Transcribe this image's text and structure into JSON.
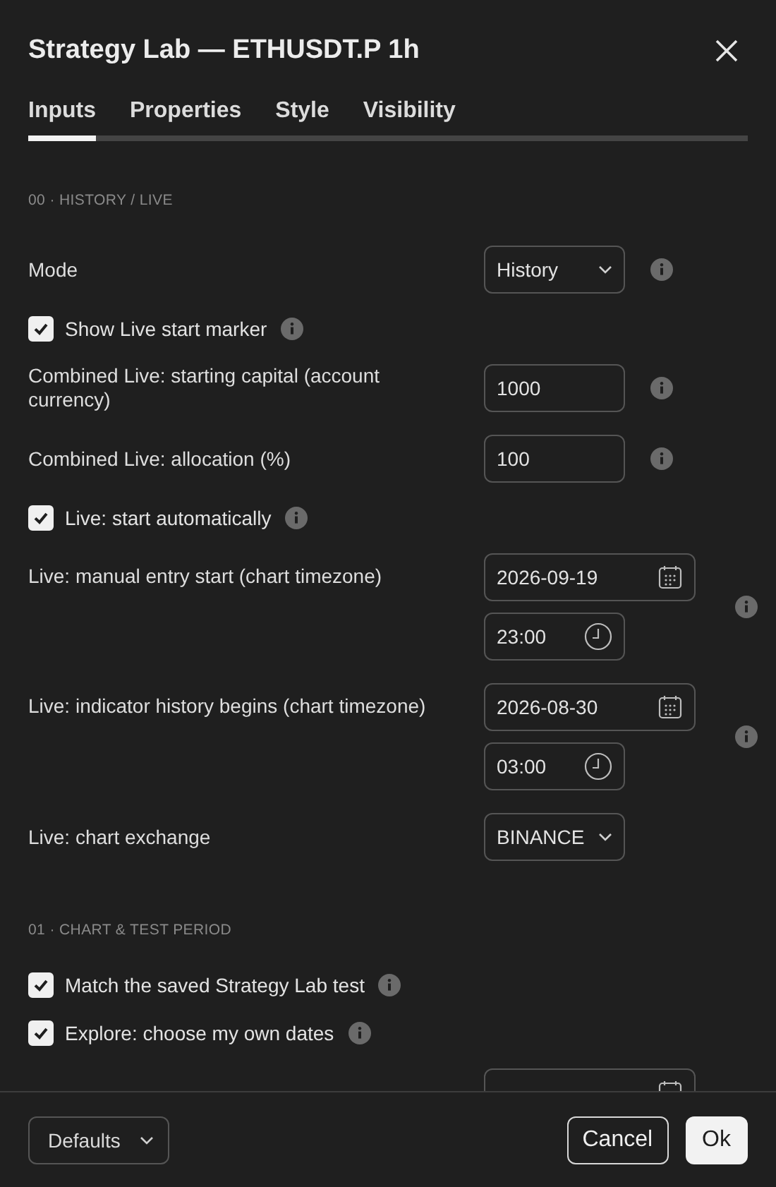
{
  "window": {
    "title": "Strategy Lab — ETHUSDT.P 1h"
  },
  "tabs": [
    {
      "label": "Inputs",
      "selected": true
    },
    {
      "label": "Properties",
      "selected": false
    },
    {
      "label": "Style",
      "selected": false
    },
    {
      "label": "Visibility",
      "selected": false
    }
  ],
  "sections": [
    {
      "heading": "00 · HISTORY / LIVE",
      "rows": [
        {
          "kind": "select",
          "label": "Mode",
          "value": "History",
          "info": true
        },
        {
          "kind": "checkbox",
          "label": "Show Live start marker",
          "checked": true,
          "info": true
        },
        {
          "kind": "number",
          "label": "Combined Live: starting capital (account currency)",
          "value": "1000",
          "info": true
        },
        {
          "kind": "number",
          "label": "Combined Live: allocation (%)",
          "value": "100",
          "info": true
        },
        {
          "kind": "checkbox",
          "label": "Live: start automatically",
          "checked": true,
          "info": true
        },
        {
          "kind": "datetime",
          "label": "Live: manual entry start (chart timezone)",
          "date": "2026-09-19",
          "time": "23:00",
          "info": true
        },
        {
          "kind": "datetime",
          "label": "Live: indicator history begins (chart timezone)",
          "date": "2026-08-30",
          "time": "03:00",
          "info": true
        },
        {
          "kind": "select",
          "label": "Live: chart exchange",
          "value": "BINANCE",
          "info": false
        }
      ]
    },
    {
      "heading": "01 · CHART & TEST PERIOD",
      "rows": [
        {
          "kind": "checkbox",
          "label": "Match the saved Strategy Lab test",
          "checked": true,
          "info": true
        },
        {
          "kind": "checkbox",
          "label": "Explore: choose my own dates",
          "checked": true,
          "info": true
        },
        {
          "kind": "cutdate"
        }
      ]
    }
  ],
  "footer": {
    "defaults": "Defaults",
    "cancel": "Cancel",
    "ok": "Ok"
  }
}
